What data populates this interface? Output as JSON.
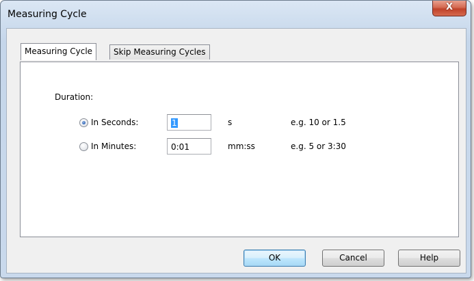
{
  "window": {
    "title": "Measuring Cycle",
    "close_label": "X"
  },
  "tabs": [
    {
      "label": "Measuring Cycle",
      "active": true
    },
    {
      "label": "Skip Measuring Cycles",
      "active": false
    }
  ],
  "duration": {
    "label": "Duration:",
    "seconds": {
      "label": "In Seconds:",
      "selected": true,
      "value": "1",
      "unit": "s",
      "hint": "e.g. 10 or 1.5"
    },
    "minutes": {
      "label": "In Minutes:",
      "selected": false,
      "value": "0:01",
      "unit": "mm:ss",
      "hint": "e.g. 5 or 3:30"
    }
  },
  "buttons": {
    "ok": "OK",
    "cancel": "Cancel",
    "help": "Help"
  },
  "colors": {
    "close_button": "#c0432a",
    "selection": "#3399ff",
    "default_button_border": "#3c7fb1"
  }
}
